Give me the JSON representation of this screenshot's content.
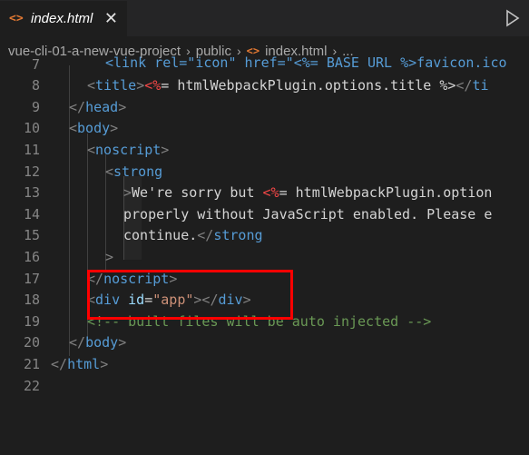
{
  "tab": {
    "icon": "<>",
    "label": "index.html",
    "close": "✕",
    "run_icon": "play-icon"
  },
  "breadcrumb": {
    "items": [
      "vue-cli-01-a-new-vue-project",
      "public",
      "index.html",
      "..."
    ],
    "separator": "›"
  },
  "editor": {
    "lines": [
      {
        "num": "7",
        "tokens": []
      },
      {
        "num": "8",
        "tokens": [
          {
            "t": "<",
            "c": "t-punc"
          },
          {
            "t": "title",
            "c": "t-tag"
          },
          {
            "t": ">",
            "c": "t-punc"
          },
          {
            "t": "<%",
            "c": "t-tmpl-open"
          },
          {
            "t": "= htmlWebpackPlugin.options.title %>",
            "c": "t-tmpl"
          },
          {
            "t": "</",
            "c": "t-punc"
          },
          {
            "t": "ti",
            "c": "t-tag"
          }
        ]
      },
      {
        "num": "9",
        "tokens": [
          {
            "t": "</",
            "c": "t-punc"
          },
          {
            "t": "head",
            "c": "t-tag"
          },
          {
            "t": ">",
            "c": "t-punc"
          }
        ]
      },
      {
        "num": "10",
        "tokens": [
          {
            "t": "<",
            "c": "t-punc"
          },
          {
            "t": "body",
            "c": "t-tag"
          },
          {
            "t": ">",
            "c": "t-punc"
          }
        ]
      },
      {
        "num": "11",
        "tokens": [
          {
            "t": "<",
            "c": "t-punc"
          },
          {
            "t": "noscript",
            "c": "t-tag"
          },
          {
            "t": ">",
            "c": "t-punc"
          }
        ]
      },
      {
        "num": "12",
        "tokens": [
          {
            "t": "<",
            "c": "t-punc"
          },
          {
            "t": "strong",
            "c": "t-tag"
          }
        ]
      },
      {
        "num": "13",
        "tokens": [
          {
            "t": ">",
            "c": "t-punc"
          },
          {
            "t": "We're sorry but ",
            "c": "t-text"
          },
          {
            "t": "<%",
            "c": "t-tmpl-open"
          },
          {
            "t": "= htmlWebpackPlugin.option",
            "c": "t-tmpl"
          }
        ]
      },
      {
        "num": "14",
        "tokens": [
          {
            "t": "properly without JavaScript enabled. Please e",
            "c": "t-text"
          }
        ]
      },
      {
        "num": "15",
        "tokens": [
          {
            "t": "continue.",
            "c": "t-text"
          },
          {
            "t": "</",
            "c": "t-punc"
          },
          {
            "t": "strong",
            "c": "t-tag"
          }
        ]
      },
      {
        "num": "16",
        "tokens": [
          {
            "t": ">",
            "c": "t-punc"
          }
        ]
      },
      {
        "num": "17",
        "tokens": [
          {
            "t": "</",
            "c": "t-punc"
          },
          {
            "t": "noscript",
            "c": "t-tag"
          },
          {
            "t": ">",
            "c": "t-punc"
          }
        ]
      },
      {
        "num": "18",
        "tokens": [
          {
            "t": "<",
            "c": "t-punc"
          },
          {
            "t": "div",
            "c": "t-tag"
          },
          {
            "t": " ",
            "c": "t-text"
          },
          {
            "t": "id",
            "c": "t-attr"
          },
          {
            "t": "=",
            "c": "t-text"
          },
          {
            "t": "\"app\"",
            "c": "t-str"
          },
          {
            "t": "></",
            "c": "t-punc"
          },
          {
            "t": "div",
            "c": "t-tag"
          },
          {
            "t": ">",
            "c": "t-punc"
          }
        ]
      },
      {
        "num": "19",
        "tokens": [
          {
            "t": "<!-- built files will be auto injected -->",
            "c": "t-comment"
          }
        ]
      },
      {
        "num": "20",
        "tokens": [
          {
            "t": "</",
            "c": "t-punc"
          },
          {
            "t": "body",
            "c": "t-tag"
          },
          {
            "t": ">",
            "c": "t-punc"
          }
        ]
      },
      {
        "num": "21",
        "tokens": [
          {
            "t": "</",
            "c": "t-punc"
          },
          {
            "t": "html",
            "c": "t-tag"
          },
          {
            "t": ">",
            "c": "t-punc"
          }
        ]
      },
      {
        "num": "22",
        "tokens": []
      }
    ]
  },
  "colors": {
    "highlight_border": "#ff0000",
    "html_icon": "#e37933"
  }
}
